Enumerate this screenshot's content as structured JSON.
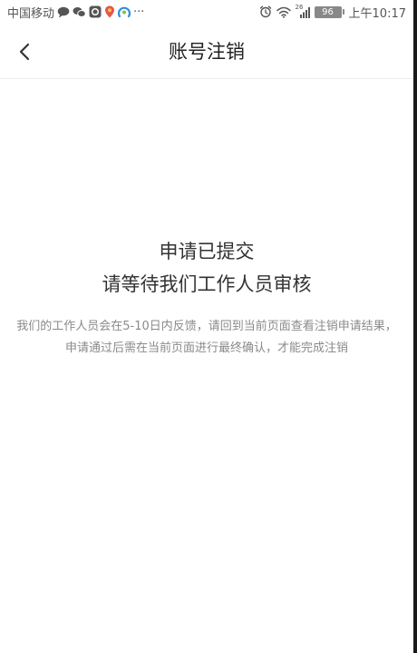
{
  "status_bar": {
    "carrier": "中国移动",
    "overflow": "···",
    "network_badge": "26",
    "battery_level": "96",
    "time": "上午10:17",
    "icons": [
      "chat-bubble-icon",
      "wechat-icon",
      "app-icon",
      "location-pin-icon",
      "browser-icon",
      "alarm-icon",
      "wifi-icon",
      "signal-icon",
      "battery-icon"
    ]
  },
  "nav": {
    "back_icon": "chevron-left-icon",
    "title": "账号注销"
  },
  "content": {
    "headline_1": "申请已提交",
    "headline_2": "请等待我们工作人员审核",
    "description": "我们的工作人员会在5-10日内反馈，请回到当前页面查看注销申请结果，申请通过后需在当前页面进行最终确认，才能完成注销"
  },
  "colors": {
    "title_text": "#222222",
    "body_text": "#333333",
    "secondary_text": "#8a8a8a",
    "divider": "#ececec"
  }
}
